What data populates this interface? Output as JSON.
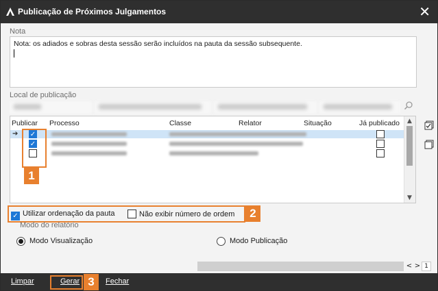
{
  "window": {
    "title": "Publicação de Próximos Julgamentos"
  },
  "note": {
    "label": "Nota",
    "value": "Nota: os adiados e sobras desta sessão serão incluídos na pauta da sessão subsequente."
  },
  "location": {
    "label": "Local de publicação"
  },
  "grid": {
    "columns": [
      "Publicar",
      "Processo",
      "Classe",
      "Relator",
      "Situação",
      "Já publicado"
    ],
    "rows": [
      {
        "publicar": true,
        "publicado": false,
        "selected": true
      },
      {
        "publicar": true,
        "publicado": false,
        "selected": false
      },
      {
        "publicar": false,
        "publicado": false,
        "selected": false
      }
    ]
  },
  "options": {
    "use_pauta_order": {
      "label": "Utilizar ordenação da pauta",
      "checked": true
    },
    "hide_order_number": {
      "label": "Não exibir número de ordem",
      "checked": false
    }
  },
  "report_mode": {
    "label": "Modo do relatório",
    "visualizacao": {
      "label": "Modo Visualização",
      "selected": true
    },
    "publicacao": {
      "label": "Modo Publicação",
      "selected": false
    }
  },
  "pager": {
    "prev": "<",
    "next": ">",
    "page": "1"
  },
  "footer": {
    "limpar": "Limpar",
    "gerar": "Gerar",
    "fechar": "Fechar"
  },
  "badges": {
    "b1": "1",
    "b2": "2",
    "b3": "3"
  },
  "colors": {
    "titlebar": "#2f2f2f",
    "accent_orange": "#e8802e",
    "check_blue": "#1e78d6",
    "selected_row": "#cfe4f7"
  }
}
